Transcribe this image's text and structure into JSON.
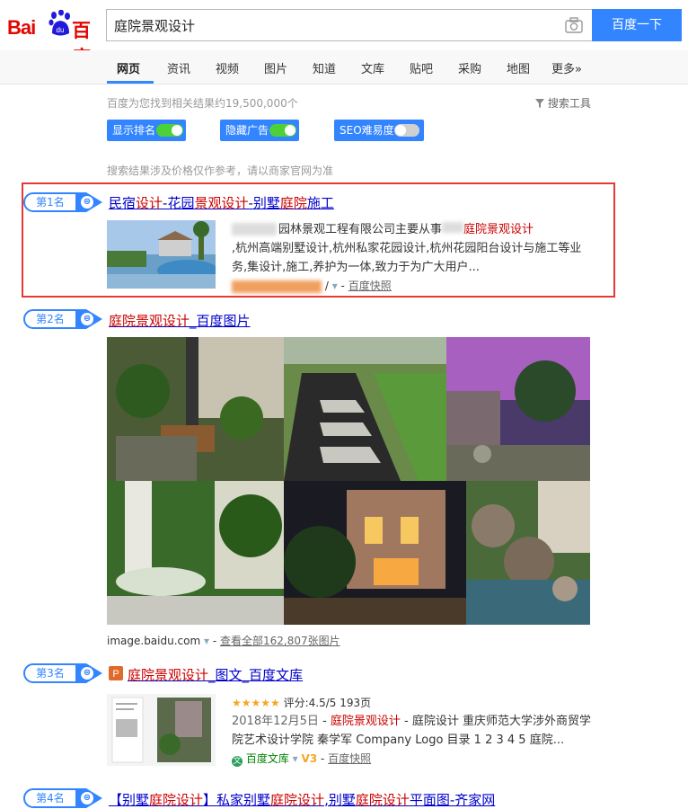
{
  "logo": {
    "left_text": "Bai",
    "right_text": "百度",
    "paw_text": "du"
  },
  "search": {
    "query": "庭院景观设计",
    "button": "百度一下"
  },
  "nav": {
    "tabs": [
      "网页",
      "资讯",
      "视频",
      "图片",
      "知道",
      "文库",
      "贴吧",
      "采购",
      "地图",
      "更多»"
    ]
  },
  "stats": "百度为您找到相关结果约19,500,000个",
  "search_tools": "搜索工具",
  "toggles": [
    {
      "label": "显示排名",
      "on": true
    },
    {
      "label": "隐藏广告",
      "on": true
    },
    {
      "label": "SEO难易度",
      "on": false
    }
  ],
  "notice": "搜索结果涉及价格仅作参考，请以商家官网为准",
  "results": [
    {
      "rank": "第1名",
      "title_parts": [
        "民宿",
        "设计",
        "-花园",
        "景观设计",
        "-别墅",
        "庭院",
        "施工"
      ],
      "desc_a": "园林景观工程有限公司主要从事",
      "desc_em": "庭院景观设计",
      "desc_b": ",杭州高端别墅设计,杭州私家花园设计,杭州花园阳台设计与施工等业务,集设计,施工,养护为一体,致力于为广大用户...",
      "snapshot": "百度快照",
      "url_tail": "/"
    },
    {
      "rank": "第2名",
      "title_em": "庭院景观设计",
      "title_rest": "_百度图片",
      "site": "image.baidu.com",
      "more": "查看全部162,807张图片"
    },
    {
      "rank": "第3名",
      "title_em": "庭院景观设计",
      "title_rest": "_图文_百度文库",
      "rating": "评分:4.5/5",
      "pages": "193页",
      "date": "2018年12月5日",
      "desc_em": "庭院景观设计",
      "desc_a": " - 庭院设计 重庆师范大学涉外商贸学院艺术设计学院 秦学军 Company Logo 目录 1 2 3 4 5 庭院...",
      "source": "百度文库",
      "level": "V3",
      "snapshot": "百度快照"
    },
    {
      "rank": "第4名",
      "title_a": "【别墅",
      "title_em1": "庭院设计",
      "title_b": "】私家别墅",
      "title_em2": "庭院设计",
      "title_c": ",别墅",
      "title_em3": "庭院设计",
      "title_d": "平面图-齐家网"
    }
  ],
  "colors": {
    "link": "#0000cc",
    "highlight": "#cc0000",
    "accent": "#3385ff",
    "redbox": "#e53935"
  }
}
